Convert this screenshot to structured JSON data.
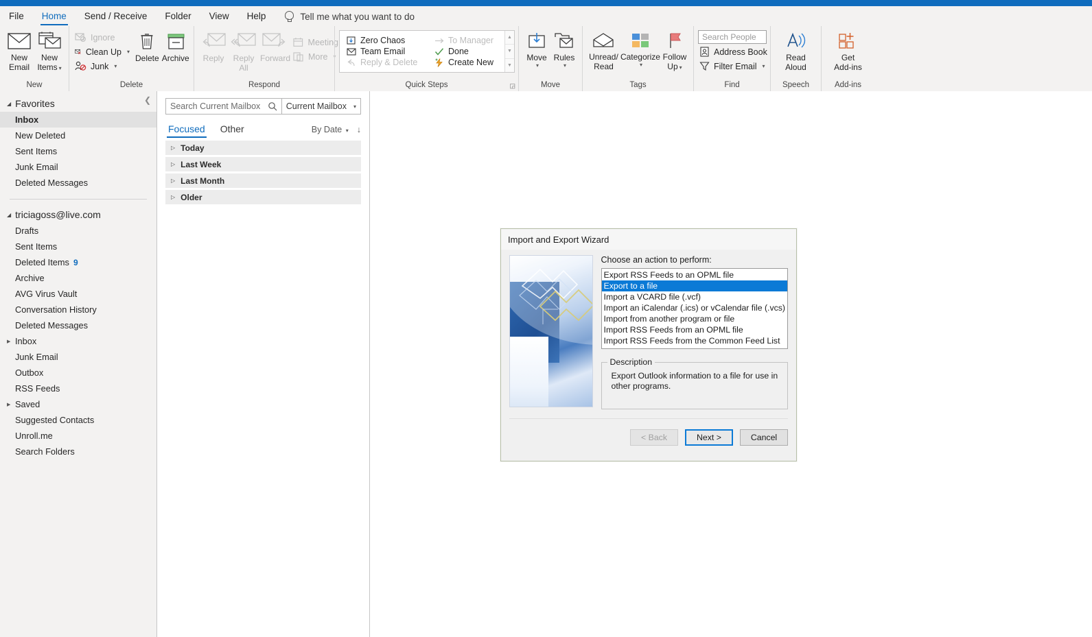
{
  "titlebar": {
    "accent_color": "#0f6cbd"
  },
  "ribbon_tabs": [
    {
      "label": "File",
      "active": false
    },
    {
      "label": "Home",
      "active": true
    },
    {
      "label": "Send / Receive",
      "active": false
    },
    {
      "label": "Folder",
      "active": false
    },
    {
      "label": "View",
      "active": false
    },
    {
      "label": "Help",
      "active": false
    }
  ],
  "tellme": {
    "label": "Tell me what you want to do",
    "icon": "lightbulb-icon"
  },
  "ribbon": {
    "groups": {
      "new": {
        "label": "New",
        "new_email": "New\nEmail",
        "new_email_line1": "New",
        "new_email_line2": "Email",
        "new_items_line1": "New",
        "new_items_line2": "Items"
      },
      "delete": {
        "label": "Delete",
        "ignore": "Ignore",
        "clean_up": "Clean Up",
        "junk": "Junk",
        "delete": "Delete",
        "archive": "Archive"
      },
      "respond": {
        "label": "Respond",
        "reply": "Reply",
        "reply_all_line1": "Reply",
        "reply_all_line2": "All",
        "forward": "Forward",
        "meeting": "Meeting",
        "more": "More"
      },
      "quicksteps": {
        "label": "Quick Steps",
        "items": [
          {
            "label": "Zero Chaos",
            "icon": "move-to-folder-icon",
            "dim": false
          },
          {
            "label": "Team Email",
            "icon": "envelope-icon",
            "dim": false
          },
          {
            "label": "Reply & Delete",
            "icon": "reply-icon",
            "dim": true
          },
          {
            "label": "To Manager",
            "icon": "arrow-right-icon",
            "dim": true
          },
          {
            "label": "Done",
            "icon": "checkmark-icon",
            "dim": false
          },
          {
            "label": "Create New",
            "icon": "lightning-icon",
            "dim": false
          }
        ]
      },
      "move": {
        "label": "Move",
        "move": "Move",
        "rules": "Rules"
      },
      "tags": {
        "label": "Tags",
        "unread_read_line1": "Unread/",
        "unread_read_line2": "Read",
        "categorize": "Categorize",
        "follow_up_line1": "Follow",
        "follow_up_line2": "Up"
      },
      "find": {
        "label": "Find",
        "search_people_placeholder": "Search People",
        "address_book": "Address Book",
        "filter_email": "Filter Email"
      },
      "speech": {
        "label": "Speech",
        "read_aloud_line1": "Read",
        "read_aloud_line2": "Aloud"
      },
      "addins": {
        "label": "Add-ins",
        "get_addins_line1": "Get",
        "get_addins_line2": "Add-ins"
      }
    }
  },
  "folder_pane": {
    "collapse_icon": "chevron-left-icon",
    "favorites": {
      "label": "Favorites",
      "items": [
        {
          "label": "Inbox",
          "selected": true
        },
        {
          "label": "New Deleted",
          "selected": false
        },
        {
          "label": "Sent Items",
          "selected": false
        },
        {
          "label": "Junk Email",
          "selected": false
        },
        {
          "label": "Deleted Messages",
          "selected": false
        }
      ]
    },
    "account": {
      "label": "triciagoss@live.com",
      "items": [
        {
          "label": "Drafts",
          "count": "",
          "expandable": false
        },
        {
          "label": "Sent Items",
          "count": "",
          "expandable": false
        },
        {
          "label": "Deleted Items",
          "count": "9",
          "expandable": false
        },
        {
          "label": "Archive",
          "count": "",
          "expandable": false
        },
        {
          "label": "AVG Virus Vault",
          "count": "",
          "expandable": false
        },
        {
          "label": "Conversation History",
          "count": "",
          "expandable": false
        },
        {
          "label": "Deleted Messages",
          "count": "",
          "expandable": false
        },
        {
          "label": "Inbox",
          "count": "",
          "expandable": true
        },
        {
          "label": "Junk Email",
          "count": "",
          "expandable": false
        },
        {
          "label": "Outbox",
          "count": "",
          "expandable": false
        },
        {
          "label": "RSS Feeds",
          "count": "",
          "expandable": false
        },
        {
          "label": "Saved",
          "count": "",
          "expandable": true
        },
        {
          "label": "Suggested Contacts",
          "count": "",
          "expandable": false
        },
        {
          "label": "Unroll.me",
          "count": "",
          "expandable": false
        },
        {
          "label": "Search Folders",
          "count": "",
          "expandable": false
        }
      ]
    }
  },
  "message_pane": {
    "search_placeholder": "Search Current Mailbox",
    "search_icon": "magnifier-icon",
    "scope_label": "Current Mailbox",
    "tabs": [
      {
        "label": "Focused",
        "active": true
      },
      {
        "label": "Other",
        "active": false
      }
    ],
    "sort_label": "By Date",
    "sort_direction_icon": "arrow-down-icon",
    "groups": [
      {
        "label": "Today"
      },
      {
        "label": "Last Week"
      },
      {
        "label": "Last Month"
      },
      {
        "label": "Older"
      }
    ]
  },
  "dialog": {
    "title": "Import and Export Wizard",
    "prompt": "Choose an action to perform:",
    "options": [
      {
        "label": "Export RSS Feeds to an OPML file",
        "selected": false
      },
      {
        "label": "Export to a file",
        "selected": true
      },
      {
        "label": "Import a VCARD file (.vcf)",
        "selected": false
      },
      {
        "label": "Import an iCalendar (.ics) or vCalendar file (.vcs)",
        "selected": false
      },
      {
        "label": "Import from another program or file",
        "selected": false
      },
      {
        "label": "Import RSS Feeds from an OPML file",
        "selected": false
      },
      {
        "label": "Import RSS Feeds from the Common Feed List",
        "selected": false
      }
    ],
    "description_legend": "Description",
    "description_text": "Export Outlook information to a file for use in other programs.",
    "buttons": {
      "back": "< Back",
      "next": "Next >",
      "cancel": "Cancel"
    },
    "selection_color": "#0b7ad6"
  }
}
